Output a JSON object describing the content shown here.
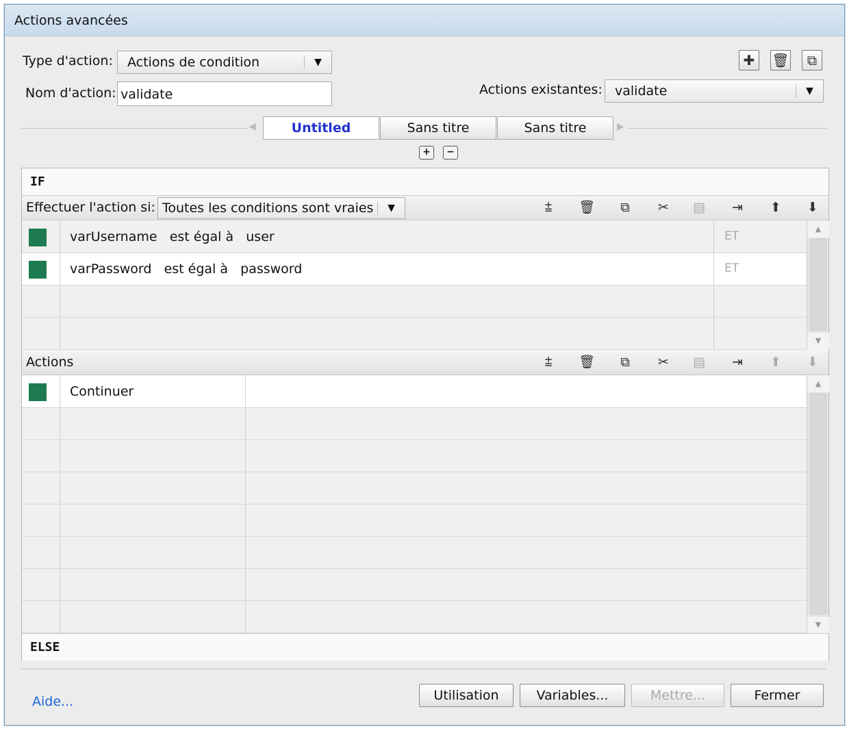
{
  "window": {
    "title": "Actions avancées"
  },
  "form": {
    "type_label": "Type d'action:",
    "type_value": "Actions de condition",
    "name_label": "Nom d'action:",
    "name_value": "validate",
    "existing_label": "Actions existantes:",
    "existing_value": "validate"
  },
  "header_icons": [
    "add-icon",
    "trash-icon",
    "duplicate-icon"
  ],
  "tabs": [
    {
      "label": "Untitled",
      "active": true
    },
    {
      "label": "Sans titre",
      "active": false
    },
    {
      "label": "Sans titre",
      "active": false
    }
  ],
  "if_section": {
    "heading": "IF",
    "condition_label": "Effectuer l'action si:",
    "condition_value": "Toutes les conditions sont vraies",
    "rows": [
      {
        "color": "#1e7a50",
        "variable": "varUsername",
        "operator": "est égal à",
        "value": "user",
        "conj": "ET"
      },
      {
        "color": "#1e7a50",
        "variable": "varPassword",
        "operator": "est égal à",
        "value": "password",
        "conj": "ET"
      }
    ]
  },
  "actions_section": {
    "heading": "Actions",
    "rows": [
      {
        "color": "#1e7a50",
        "action": "Continuer"
      }
    ]
  },
  "else_section": {
    "heading": "ELSE"
  },
  "footer": {
    "help": "Aide...",
    "usage": "Utilisation",
    "variables": "Variables...",
    "update": "Mettre...",
    "close": "Fermer"
  }
}
